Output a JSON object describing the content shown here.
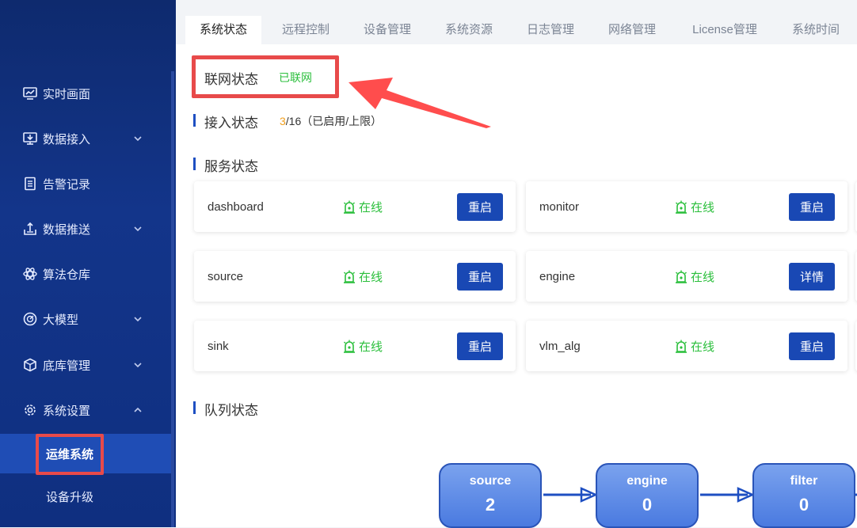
{
  "sidebar": {
    "items": [
      {
        "label": "实时画面",
        "icon": "monitor-chart-icon",
        "expand": false
      },
      {
        "label": "数据接入",
        "icon": "desktop-import-icon",
        "expand": true
      },
      {
        "label": "告警记录",
        "icon": "document-list-icon",
        "expand": false
      },
      {
        "label": "数据推送",
        "icon": "upload-tray-icon",
        "expand": true
      },
      {
        "label": "算法仓库",
        "icon": "atom-icon",
        "expand": false
      },
      {
        "label": "大模型",
        "icon": "model-gauge-icon",
        "expand": true
      },
      {
        "label": "底库管理",
        "icon": "cube-icon",
        "expand": true
      },
      {
        "label": "系统设置",
        "icon": "gear-icon",
        "expand": true
      }
    ],
    "sub_items": [
      {
        "label": "运维系统",
        "active": true
      },
      {
        "label": "设备升级",
        "active": false
      }
    ]
  },
  "tabs": [
    {
      "label": "系统状态",
      "active": true
    },
    {
      "label": "远程控制"
    },
    {
      "label": "设备管理"
    },
    {
      "label": "系统资源"
    },
    {
      "label": "日志管理"
    },
    {
      "label": "网络管理"
    },
    {
      "label": "License管理"
    },
    {
      "label": "系统时间"
    }
  ],
  "network": {
    "title": "联网状态",
    "status": "已联网"
  },
  "access": {
    "title": "接入状态",
    "used": "3",
    "rest": "/16（已启用/上限）"
  },
  "services": {
    "title": "服务状态",
    "cards": [
      {
        "name": "dashboard",
        "status": "在线",
        "action": "重启"
      },
      {
        "name": "monitor",
        "status": "在线",
        "action": "重启"
      },
      {
        "name": "source",
        "status": "在线",
        "action": "重启"
      },
      {
        "name": "engine",
        "status": "在线",
        "action": "详情"
      },
      {
        "name": "sink",
        "status": "在线",
        "action": "重启"
      },
      {
        "name": "vlm_alg",
        "status": "在线",
        "action": "重启"
      }
    ]
  },
  "queue": {
    "title": "队列状态",
    "nodes": [
      {
        "label": "source",
        "value": "2"
      },
      {
        "label": "engine",
        "value": "0"
      },
      {
        "label": "filter",
        "value": "0"
      }
    ]
  },
  "colors": {
    "accent": "#1948b4",
    "online": "#2bbf3c",
    "highlight": "#e84a4a",
    "sidebar": "#13358a",
    "warning": "#f0a020"
  }
}
